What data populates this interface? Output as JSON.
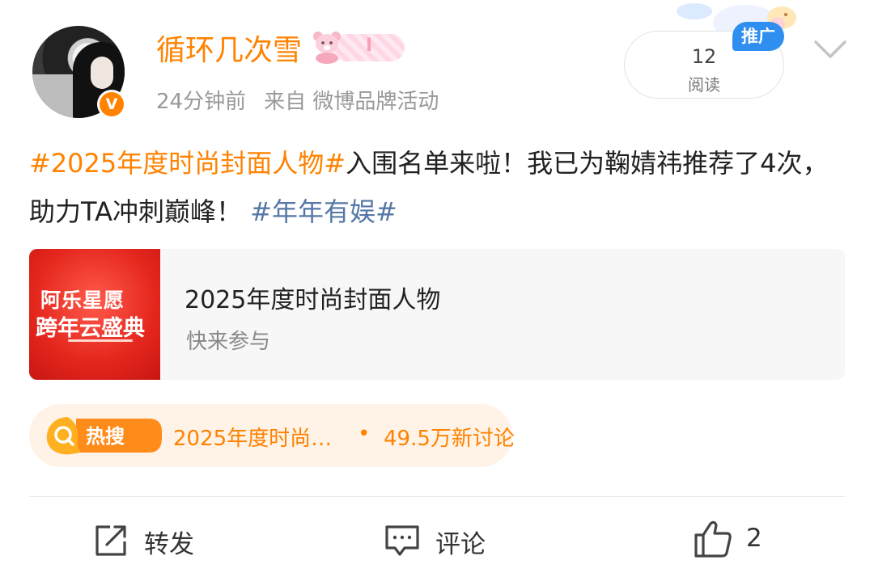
{
  "user": {
    "name": "循环几次雪",
    "verified_badge": "V",
    "medal_text": "I",
    "time": "24分钟前",
    "source": "来自 微博品牌活动"
  },
  "reads": {
    "count": "12",
    "label": "阅读"
  },
  "promo_label": "推广",
  "post": {
    "topic1": "#2025年度时尚封面人物#",
    "text1": "入围名单来啦！我已为鞠婧祎推荐了4次，助力TA冲刺巅峰！",
    "topic2": "#年年有娱#"
  },
  "card": {
    "thumb_line1": "阿乐星愿",
    "thumb_line2": "跨年云盛典",
    "title": "2025年度时尚封面人物",
    "subtitle": "快来参与"
  },
  "hot_search": {
    "badge": "热搜",
    "topic": "2025年度时尚…",
    "separator": "•",
    "discussions": "49.5万新讨论"
  },
  "actions": {
    "repost": "转发",
    "comment": "评论",
    "like_count": "2"
  },
  "colors": {
    "accent_orange": "#ff8200",
    "topic_blue": "#5577a6",
    "promo_blue": "#2e8ff0"
  },
  "icons": [
    "verified-icon",
    "bear-sticker-icon",
    "chevron-down-icon",
    "search-icon",
    "repost-icon",
    "comment-icon",
    "like-icon"
  ]
}
